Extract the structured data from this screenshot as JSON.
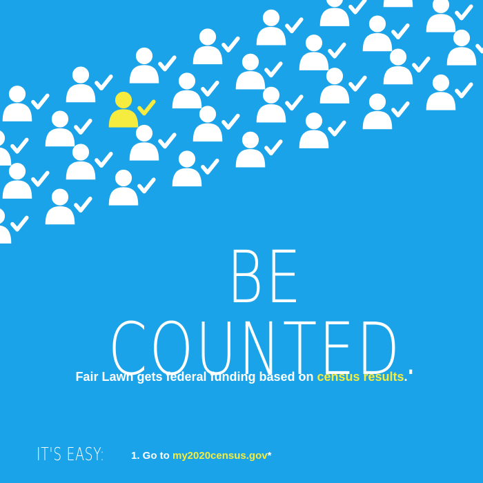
{
  "colors": {
    "background": "#1aa3e8",
    "primary_text": "#ffffff",
    "accent": "#f5ec3f"
  },
  "icons": {
    "person": "person-check-icon",
    "highlighted_person": "person-check-icon-yellow"
  },
  "headline": "BE COUNTED.",
  "funding": {
    "text_before": "Fair Lawn gets federal funding based on ",
    "highlight": "census results",
    "text_after": "."
  },
  "instructions": {
    "label": "IT'S EASY:",
    "step_prefix": "1. Go to ",
    "step_link": "my2020census.gov",
    "step_suffix": "*"
  }
}
